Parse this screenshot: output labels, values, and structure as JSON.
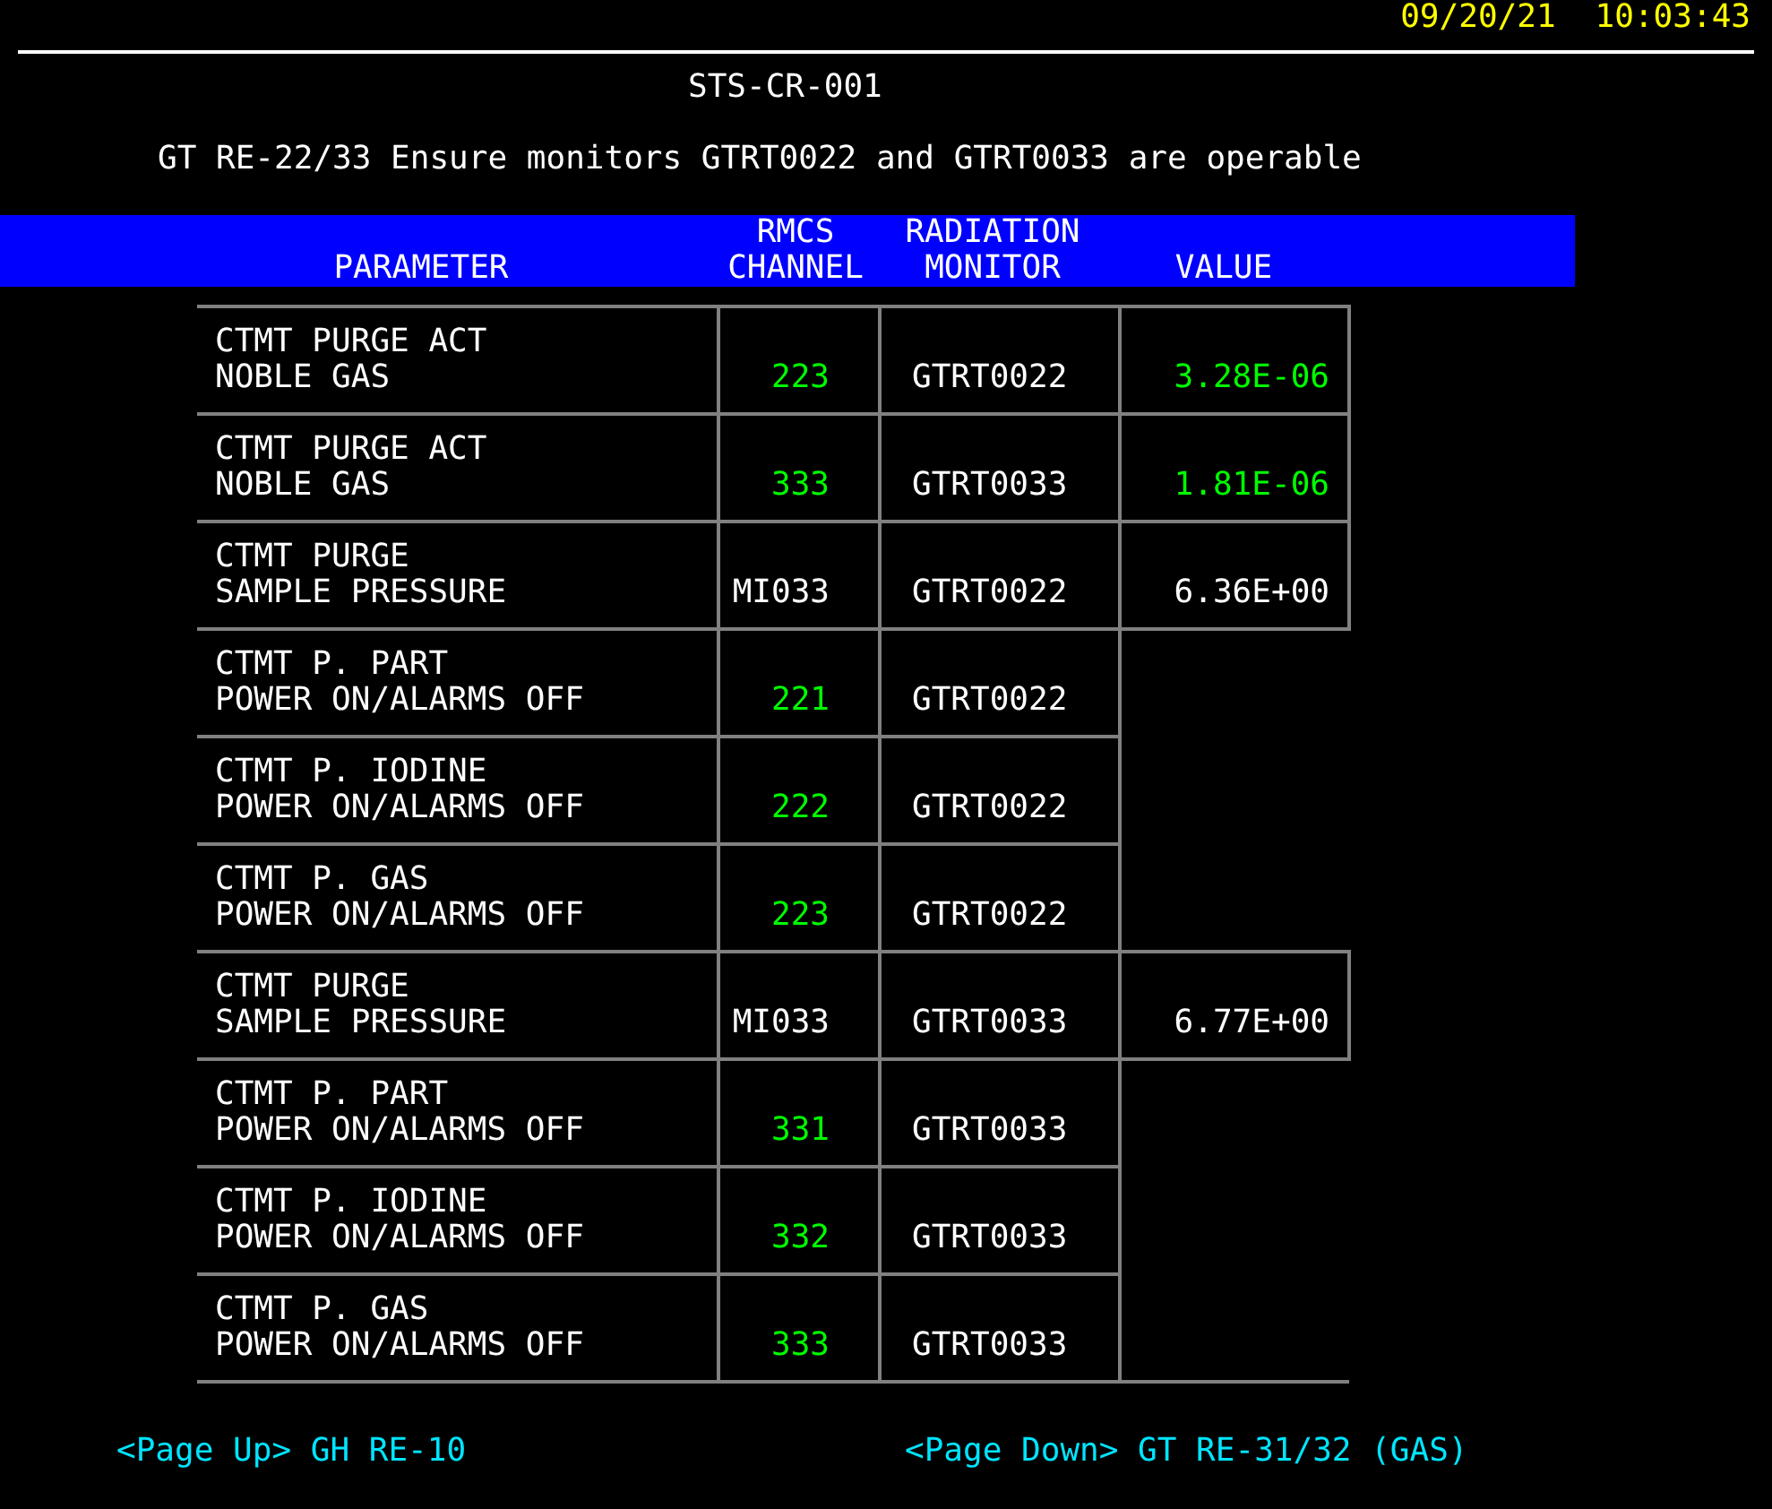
{
  "clock": {
    "date": "09/20/21",
    "time": "10:03:43"
  },
  "title": "STS-CR-001",
  "subtitle": "GT RE-22/33 Ensure monitors GTRT0022 and GTRT0033 are operable",
  "table": {
    "columns": [
      "PARAMETER",
      "RMCS\nCHANNEL",
      "RADIATION\nMONITOR",
      "VALUE"
    ],
    "rows": [
      {
        "parameter": "CTMT PURGE ACT\nNOBLE GAS",
        "channel": {
          "text": "223",
          "color": "#00ff00"
        },
        "monitor": "GTRT0022",
        "value": {
          "text": "3.28E-06",
          "color": "#00ff00"
        }
      },
      {
        "parameter": "CTMT PURGE ACT\nNOBLE GAS",
        "channel": {
          "text": "333",
          "color": "#00ff00"
        },
        "monitor": "GTRT0033",
        "value": {
          "text": "1.81E-06",
          "color": "#00ff00"
        }
      },
      {
        "parameter": "CTMT PURGE\nSAMPLE PRESSURE",
        "channel": {
          "text": "MI033",
          "color": "#ffffff"
        },
        "monitor": "GTRT0022",
        "value": {
          "text": "6.36E+00",
          "color": "#ffffff"
        }
      },
      {
        "parameter": "CTMT P. PART\nPOWER ON/ALARMS OFF",
        "channel": {
          "text": "221",
          "color": "#00ff00"
        },
        "monitor": "GTRT0022"
      },
      {
        "parameter": "CTMT P. IODINE\nPOWER ON/ALARMS OFF",
        "channel": {
          "text": "222",
          "color": "#00ff00"
        },
        "monitor": "GTRT0022"
      },
      {
        "parameter": "CTMT P. GAS\nPOWER ON/ALARMS OFF",
        "channel": {
          "text": "223",
          "color": "#00ff00"
        },
        "monitor": "GTRT0022"
      },
      {
        "parameter": "CTMT PURGE\nSAMPLE PRESSURE",
        "channel": {
          "text": "MI033",
          "color": "#ffffff"
        },
        "monitor": "GTRT0033",
        "value": {
          "text": "6.77E+00",
          "color": "#ffffff"
        }
      },
      {
        "parameter": "CTMT P. PART\nPOWER ON/ALARMS OFF",
        "channel": {
          "text": "331",
          "color": "#00ff00"
        },
        "monitor": "GTRT0033"
      },
      {
        "parameter": "CTMT P. IODINE\nPOWER ON/ALARMS OFF",
        "channel": {
          "text": "332",
          "color": "#00ff00"
        },
        "monitor": "GTRT0033"
      },
      {
        "parameter": "CTMT P. GAS\nPOWER ON/ALARMS OFF",
        "channel": {
          "text": "333",
          "color": "#00ff00"
        },
        "monitor": "GTRT0033"
      }
    ]
  },
  "footer": {
    "page_up": "<Page Up> GH RE-10",
    "page_down": "<Page Down> GT RE-31/32 (GAS)"
  }
}
